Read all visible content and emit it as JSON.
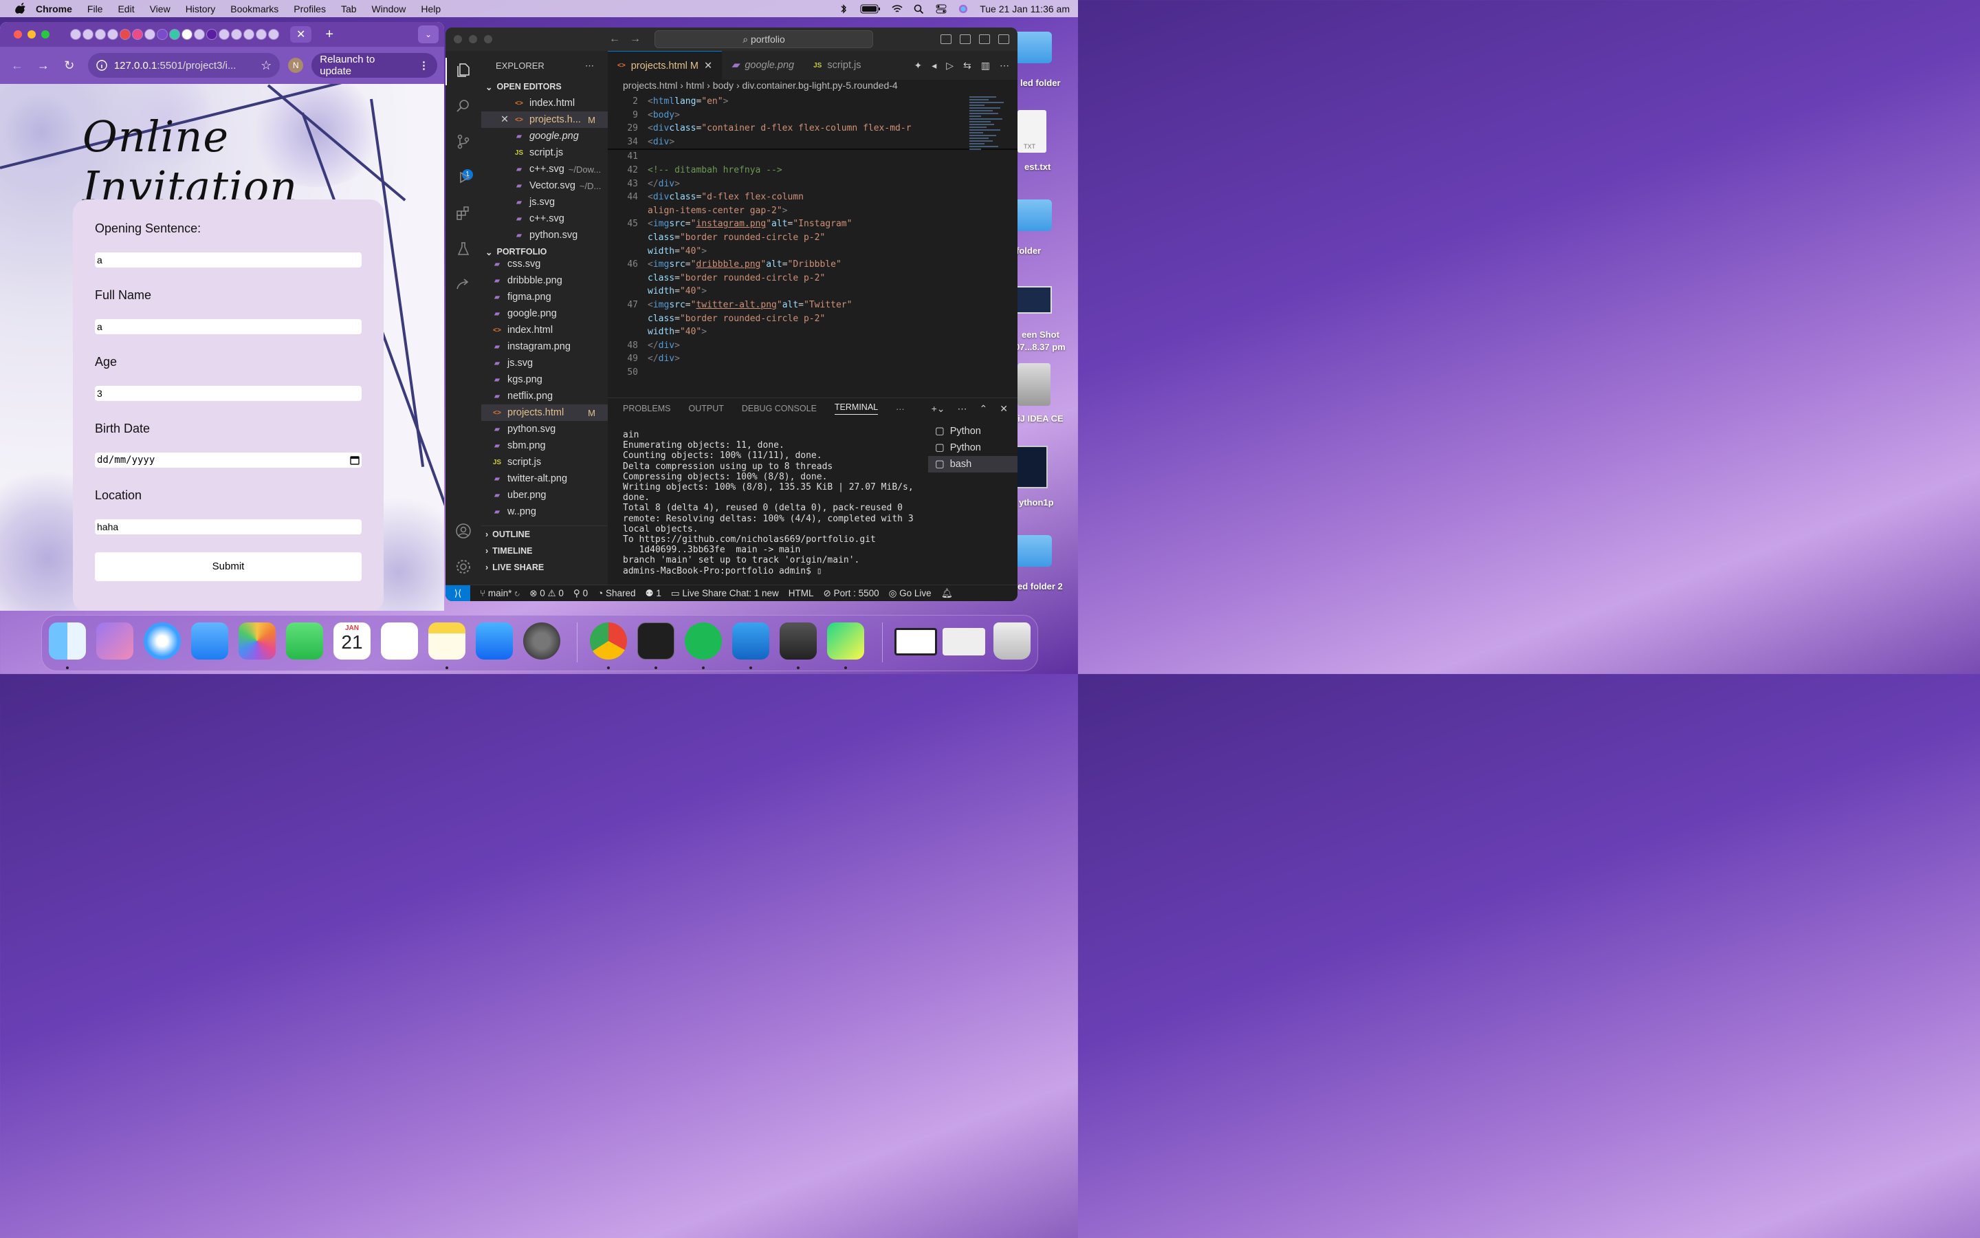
{
  "menubar": {
    "app": "Chrome",
    "items": [
      "File",
      "Edit",
      "View",
      "History",
      "Bookmarks",
      "Profiles",
      "Tab",
      "Window",
      "Help"
    ],
    "datetime": "Tue 21 Jan  11:36 am"
  },
  "desktop": {
    "labels": [
      "led folder",
      "est.txt",
      "folder",
      "een Shot",
      "07...8.37 pm",
      "iJ IDEA CE",
      "ython1p",
      "ed folder 2"
    ],
    "txt_badge": "TXT"
  },
  "chrome": {
    "tab_close": "✕",
    "new_tab": "+",
    "url_host": "127.0.0.1",
    "url_rest": ":5501/project3/i...",
    "profile_initial": "N",
    "relaunch": "Relaunch to update",
    "page": {
      "title": "Online Invitation",
      "fields": [
        {
          "label": "Opening Sentence:",
          "value": "a"
        },
        {
          "label": "Full Name",
          "value": "a"
        },
        {
          "label": "Age",
          "value": "3"
        },
        {
          "label": "Birth Date",
          "value": "dd/mm/yyyy"
        },
        {
          "label": "Location",
          "value": "haha"
        }
      ],
      "submit": "Submit"
    }
  },
  "vscode": {
    "search": "portfolio",
    "explorer_title": "EXPLORER",
    "open_editors_title": "OPEN EDITORS",
    "open_editors": [
      {
        "name": "index.html",
        "type": "html"
      },
      {
        "name": "projects.h...",
        "type": "html",
        "badge": "M",
        "selected": true
      },
      {
        "name": "google.png",
        "type": "img"
      },
      {
        "name": "script.js",
        "type": "js"
      },
      {
        "name": "c++.svg",
        "type": "img",
        "path": "~/Dow..."
      },
      {
        "name": "Vector.svg",
        "type": "img",
        "path": "~/D..."
      },
      {
        "name": "js.svg",
        "type": "img"
      },
      {
        "name": "c++.svg",
        "type": "img"
      },
      {
        "name": "python.svg",
        "type": "img"
      }
    ],
    "portfolio_title": "PORTFOLIO",
    "portfolio_files": [
      {
        "name": "css.svg",
        "type": "img"
      },
      {
        "name": "dribbble.png",
        "type": "img"
      },
      {
        "name": "figma.png",
        "type": "img"
      },
      {
        "name": "google.png",
        "type": "img"
      },
      {
        "name": "index.html",
        "type": "html"
      },
      {
        "name": "instagram.png",
        "type": "img"
      },
      {
        "name": "js.svg",
        "type": "img"
      },
      {
        "name": "kgs.png",
        "type": "img"
      },
      {
        "name": "netflix.png",
        "type": "img"
      },
      {
        "name": "projects.html",
        "type": "html",
        "badge": "M",
        "selected": true
      },
      {
        "name": "python.svg",
        "type": "img"
      },
      {
        "name": "sbm.png",
        "type": "img"
      },
      {
        "name": "script.js",
        "type": "js"
      },
      {
        "name": "twitter-alt.png",
        "type": "img"
      },
      {
        "name": "uber.png",
        "type": "img"
      },
      {
        "name": "w..png",
        "type": "img"
      }
    ],
    "outline": "OUTLINE",
    "timeline": "TIMELINE",
    "live_share": "LIVE SHARE",
    "tabs": [
      {
        "name": "projects.html",
        "badge": "M",
        "active": true
      },
      {
        "name": "google.png"
      },
      {
        "name": "script.js"
      }
    ],
    "breadcrumbs": "projects.html › html › body › div.container.bg-light.py-5.rounded-4",
    "panel_tabs": [
      "PROBLEMS",
      "OUTPUT",
      "DEBUG CONSOLE",
      "TERMINAL"
    ],
    "terminal_text": "ain\nEnumerating objects: 11, done.\nCounting objects: 100% (11/11), done.\nDelta compression using up to 8 threads\nCompressing objects: 100% (8/8), done.\nWriting objects: 100% (8/8), 135.35 KiB | 27.07 MiB/s, done.\nTotal 8 (delta 4), reused 0 (delta 0), pack-reused 0\nremote: Resolving deltas: 100% (4/4), completed with 3 local objects.\nTo https://github.com/nicholas669/portfolio.git\n   1d40699..3bb63fe  main -> main\nbranch 'main' set up to track 'origin/main'.\nadmins-MacBook-Pro:portfolio admin$ ▯",
    "terminals": [
      "Python",
      "Python",
      "bash"
    ],
    "status": {
      "branch": "main*",
      "problems": "⊗ 0  ⚠ 0",
      "ports": "0",
      "shared": "Shared",
      "participants": "1",
      "chat": "Live Share Chat: 1 new",
      "lang": "HTML",
      "port": "Port : 5500",
      "golive": "Go Live"
    }
  },
  "dock": {
    "calendar_month": "JAN",
    "calendar_day": "21"
  }
}
